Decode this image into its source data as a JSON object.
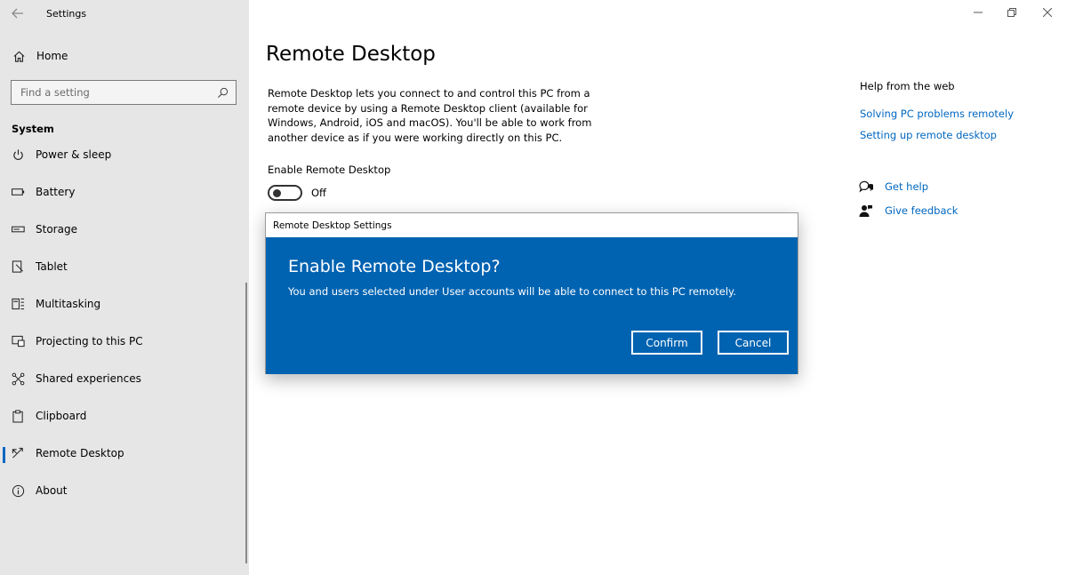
{
  "window": {
    "title": "Settings",
    "minimize_label": "—",
    "restore_label": "⧉",
    "close_label": "✕"
  },
  "sidebar": {
    "home_label": "Home",
    "search_placeholder": "Find a setting",
    "section_title": "System",
    "items": [
      {
        "label": "Power & sleep",
        "icon": "power-icon"
      },
      {
        "label": "Battery",
        "icon": "battery-icon"
      },
      {
        "label": "Storage",
        "icon": "storage-icon"
      },
      {
        "label": "Tablet",
        "icon": "tablet-icon"
      },
      {
        "label": "Multitasking",
        "icon": "multitasking-icon"
      },
      {
        "label": "Projecting to this PC",
        "icon": "projecting-icon"
      },
      {
        "label": "Shared experiences",
        "icon": "shared-experiences-icon"
      },
      {
        "label": "Clipboard",
        "icon": "clipboard-icon"
      },
      {
        "label": "Remote Desktop",
        "icon": "remote-desktop-icon",
        "active": true
      },
      {
        "label": "About",
        "icon": "about-icon"
      }
    ]
  },
  "main": {
    "title": "Remote Desktop",
    "description": "Remote Desktop lets you connect to and control this PC from a remote device by using a Remote Desktop client (available for Windows, Android, iOS and macOS). You'll be able to work from another device as if you were working directly on this PC.",
    "toggle_label": "Enable Remote Desktop",
    "toggle_state": "Off",
    "toggle_on": false
  },
  "help": {
    "title": "Help from the web",
    "links": [
      "Solving PC problems remotely",
      "Setting up remote desktop"
    ],
    "get_help": "Get help",
    "give_feedback": "Give feedback"
  },
  "dialog": {
    "window_title": "Remote Desktop Settings",
    "heading": "Enable Remote Desktop?",
    "message": "You and users selected under User accounts will be able to connect to this PC remotely.",
    "confirm_label": "Confirm",
    "cancel_label": "Cancel"
  },
  "colors": {
    "accent": "#0067c0",
    "dialog_bg": "#0063b1",
    "sidebar_bg": "#e6e6e6"
  }
}
